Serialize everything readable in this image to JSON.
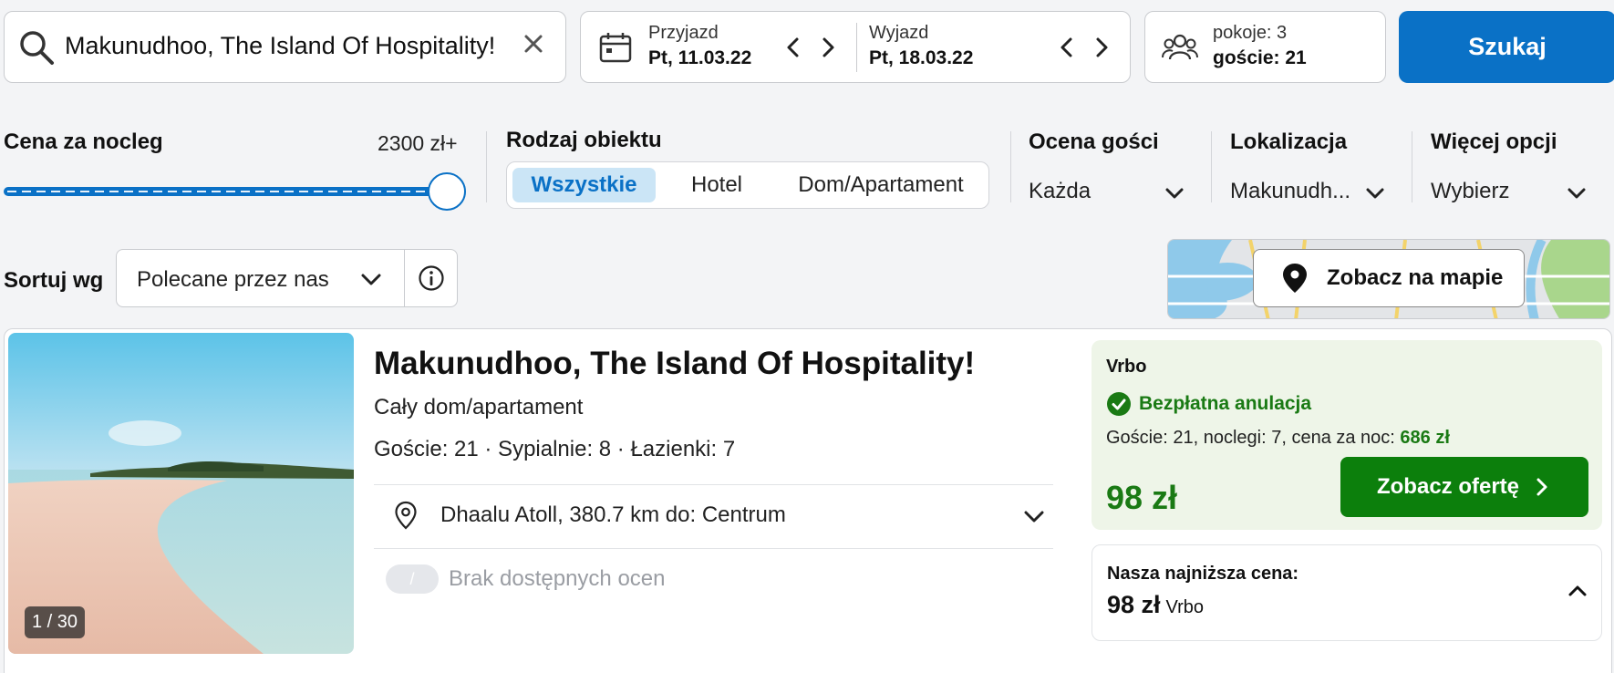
{
  "search": {
    "destination": "Makunudhoo, The Island Of Hospitality!",
    "checkin_label": "Przyjazd",
    "checkin_value": "Pt, 11.03.22",
    "checkout_label": "Wyjazd",
    "checkout_value": "Pt, 18.03.22",
    "rooms": "pokoje: 3",
    "guests": "goście: 21",
    "button": "Szukaj"
  },
  "filters": {
    "price_label": "Cena za nocleg",
    "price_value": "2300 zł+",
    "price_fraction": 1.0,
    "type_label": "Rodzaj obiektu",
    "type_options": [
      "Wszystkie",
      "Hotel",
      "Dom/Apartament"
    ],
    "type_selected": "Wszystkie",
    "rating_label": "Ocena gości",
    "rating_value": "Każda",
    "location_label": "Lokalizacja",
    "location_value": "Makunudh...",
    "more_label": "Więcej opcji",
    "more_value": "Wybierz"
  },
  "sort": {
    "label": "Sortuj wg",
    "value": "Polecane przez nas"
  },
  "map": {
    "button": "Zobacz na mapie"
  },
  "result": {
    "title": "Makunudhoo, The Island Of Hospitality!",
    "type": "Cały dom/apartament",
    "meta": "Goście: 21 · Sypialnie: 8 · Łazienki: 7",
    "location": "Dhaalu Atoll, 380.7 km do: Centrum",
    "rating_pill": "/",
    "rating_text": "Brak dostępnych ocen",
    "photo_counter": "1 / 30",
    "offer": {
      "provider": "Vrbo",
      "free_cancel": "Bezpłatna anulacja",
      "details": "Goście: 21, noclegi: 7, cena za noc:",
      "per_night": "686 zł",
      "price": "98 zł",
      "button": "Zobacz ofertę"
    },
    "lowest": {
      "label": "Nasza najniższa cena:",
      "price": "98 zł",
      "provider": "Vrbo"
    }
  },
  "colors": {
    "primary_blue": "#0a71c6",
    "offer_green": "#1a7a14",
    "offer_bg": "#eef5e8"
  }
}
